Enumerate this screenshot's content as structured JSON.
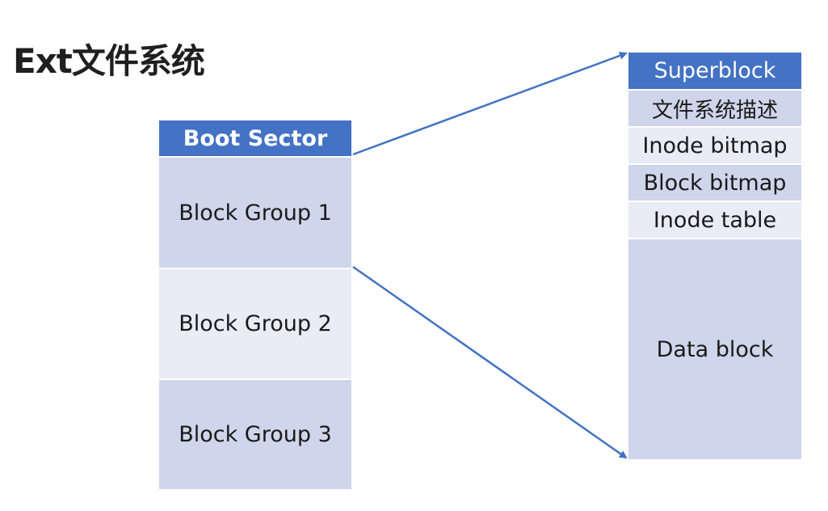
{
  "title": "Ext文件系统",
  "left_table": {
    "header": "Boot Sector",
    "rows": [
      "Block Group 1",
      "Block Group 2",
      "Block Group 3"
    ]
  },
  "right_table": {
    "header": "Superblock",
    "rows": [
      "文件系统描述",
      "Inode bitmap",
      "Block bitmap",
      "Inode table",
      "Data block"
    ]
  },
  "colors": {
    "accent": "#4472c4",
    "row_dark": "#cfd5ea",
    "row_light": "#e9ebf5",
    "arrow": "#4472c4"
  }
}
